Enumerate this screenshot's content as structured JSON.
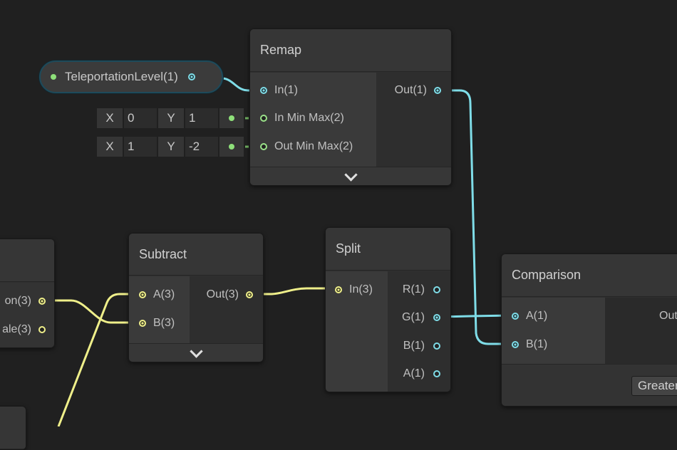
{
  "colors": {
    "background": "#202020",
    "float_wire": "#7fdde8",
    "vector3_wire": "#efef8a",
    "vector2_port": "#9be38a"
  },
  "property": {
    "label": "TeleportationLevel(1)"
  },
  "vector_fields": [
    {
      "x_label": "X",
      "x": "0",
      "y_label": "Y",
      "y": "1"
    },
    {
      "x_label": "X",
      "x": "1",
      "y_label": "Y",
      "y": "-2"
    }
  ],
  "remap": {
    "title": "Remap",
    "inputs": [
      "In(1)",
      "In Min Max(2)",
      "Out Min Max(2)"
    ],
    "outputs": [
      "Out(1)"
    ]
  },
  "left_node": {
    "outputs": [
      "on(3)",
      "ale(3)"
    ]
  },
  "subtract": {
    "title": "Subtract",
    "inputs": [
      "A(3)",
      "B(3)"
    ],
    "outputs": [
      "Out(3)"
    ]
  },
  "split": {
    "title": "Split",
    "inputs": [
      "In(3)"
    ],
    "outputs": [
      "R(1)",
      "G(1)",
      "B(1)",
      "A(1)"
    ]
  },
  "comparison": {
    "title": "Comparison",
    "inputs": [
      "A(1)",
      "B(1)"
    ],
    "outputs": [
      "Out"
    ],
    "mode": "Greater"
  }
}
